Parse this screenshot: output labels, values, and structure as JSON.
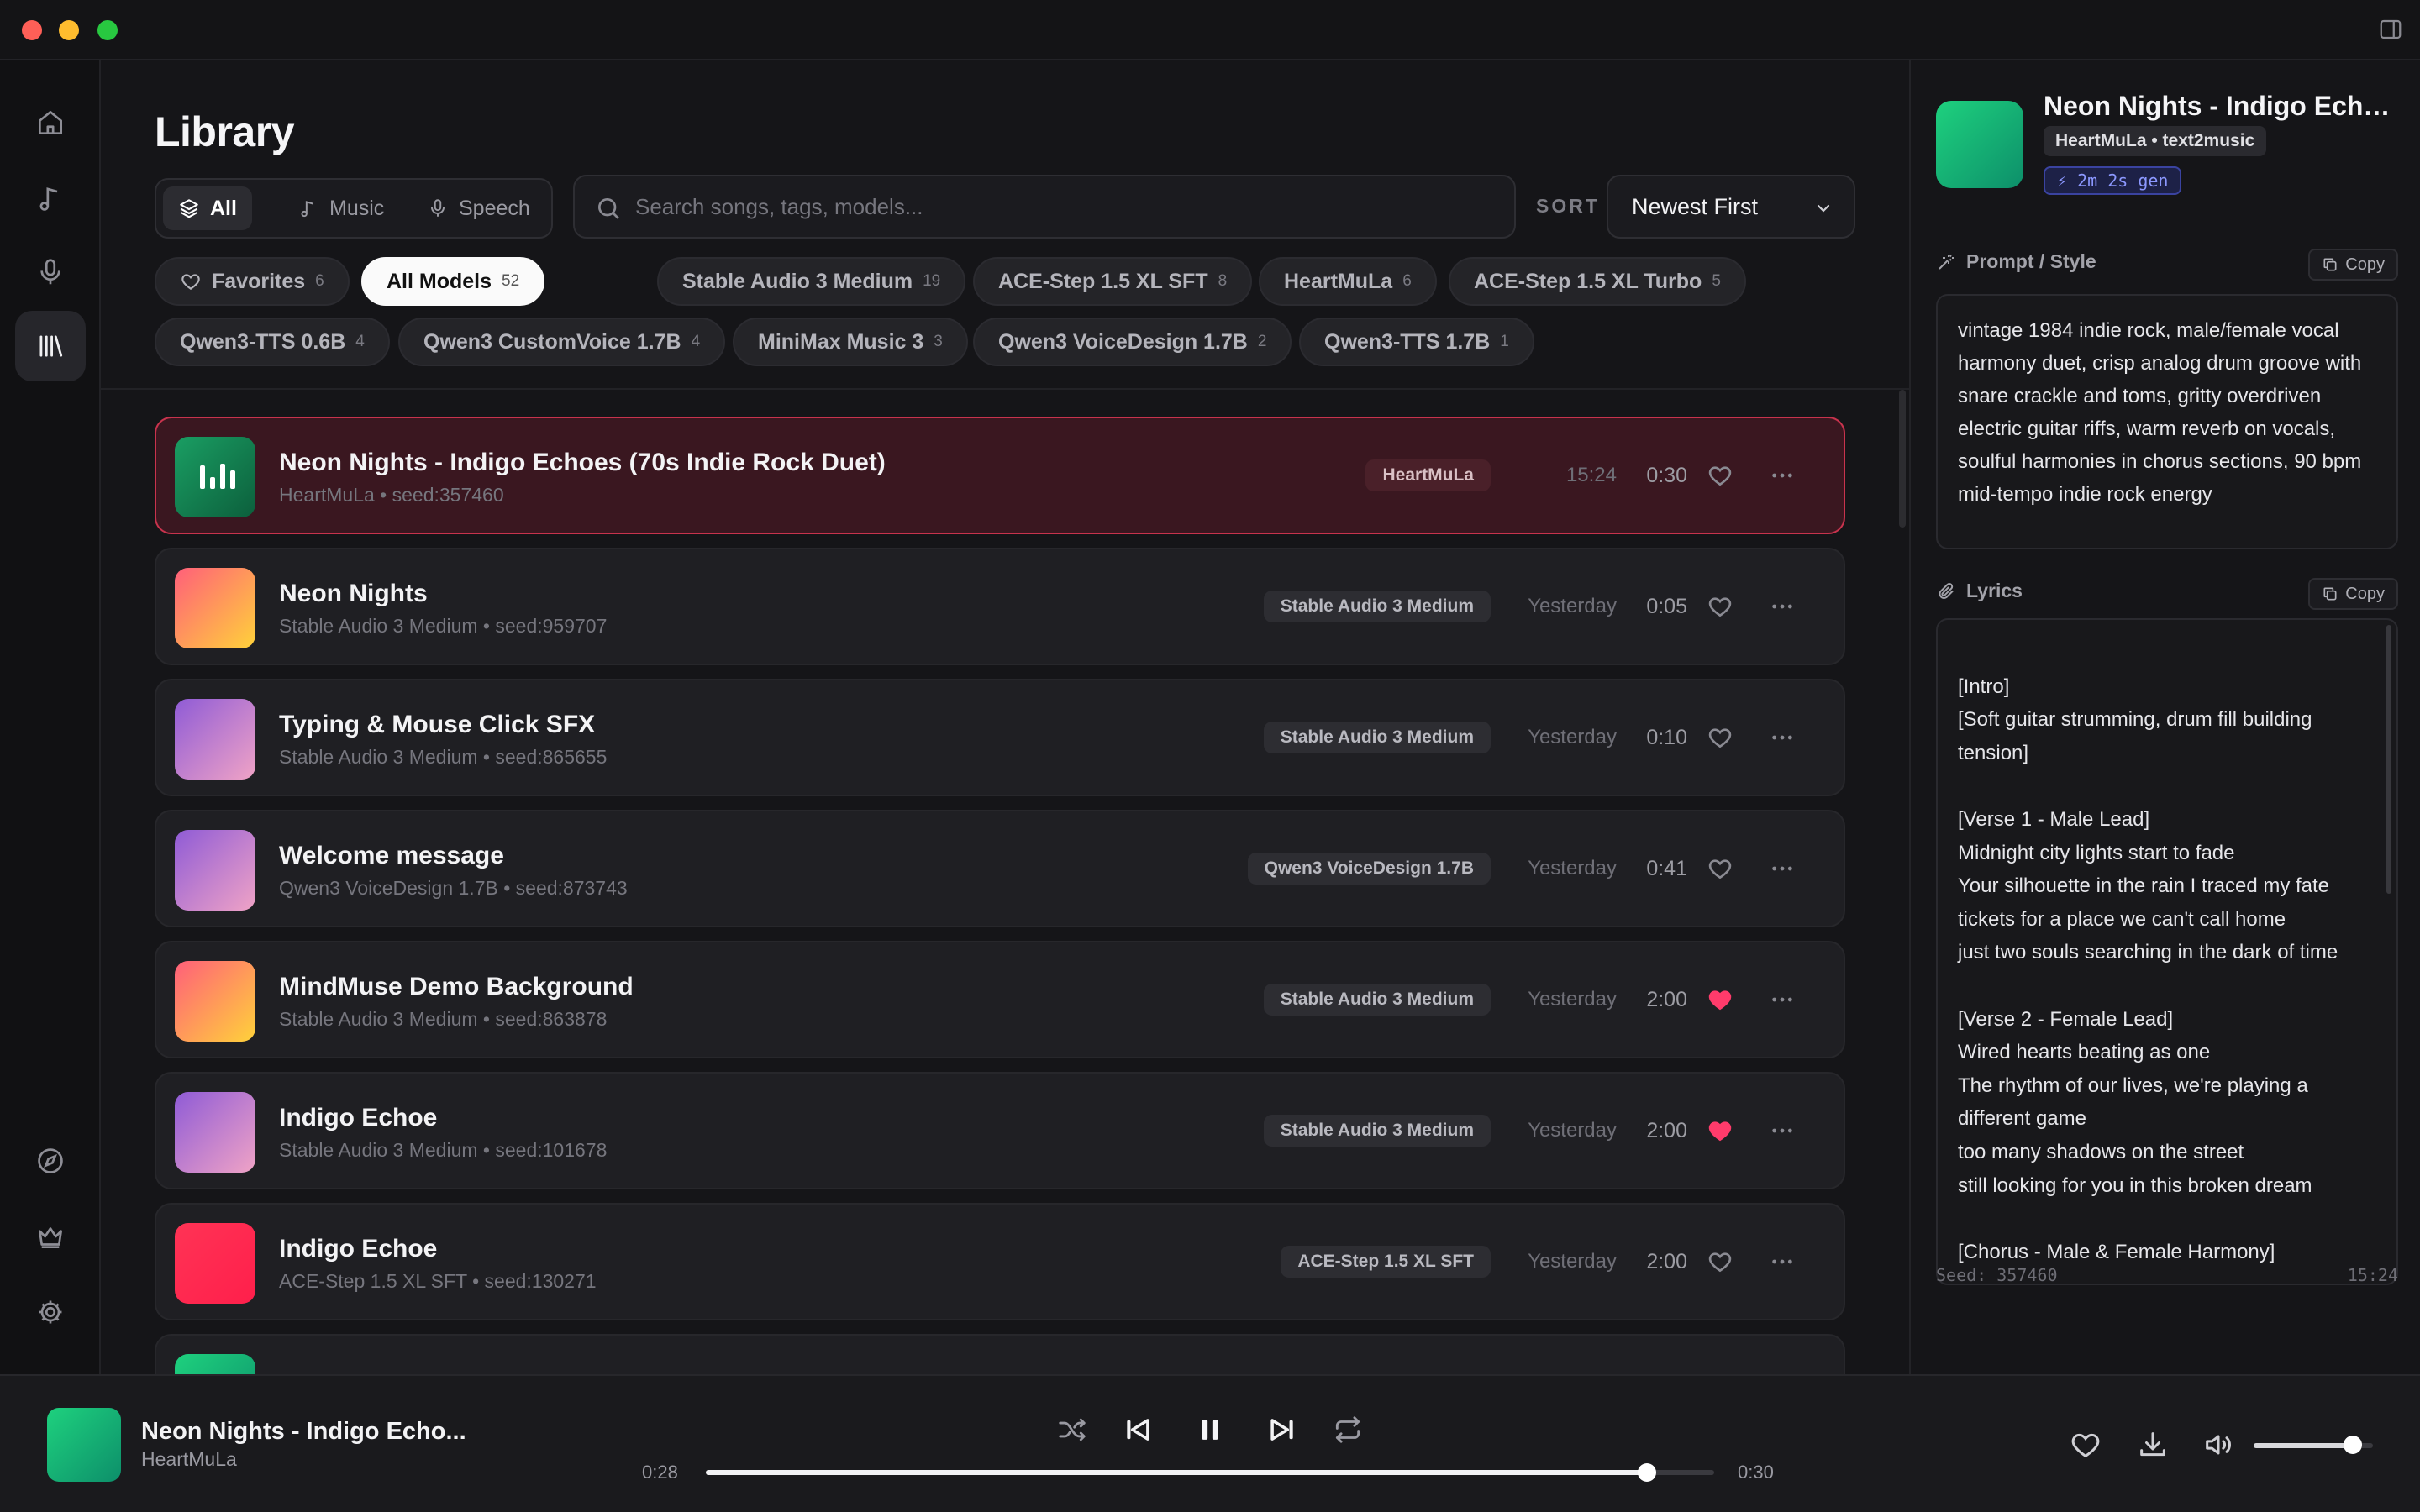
{
  "library": {
    "title": "Library",
    "tabs": [
      {
        "label": "All",
        "active": true,
        "icon": "layers-icon"
      },
      {
        "label": "Music",
        "active": false,
        "icon": "music-note-icon"
      },
      {
        "label": "Speech",
        "active": false,
        "icon": "microphone-icon"
      }
    ],
    "search": {
      "placeholder": "Search songs, tags, models...",
      "value": ""
    },
    "sort": {
      "label": "SORT",
      "value": "Newest First"
    },
    "filters": [
      {
        "label": "Favorites",
        "count": "6",
        "icon": "heart-icon"
      },
      {
        "label": "All Models",
        "count": "52",
        "active": true
      },
      {
        "label": "Stable Audio 3 Medium",
        "count": "19"
      },
      {
        "label": "ACE-Step 1.5 XL SFT",
        "count": "8"
      },
      {
        "label": "HeartMuLa",
        "count": "6"
      },
      {
        "label": "ACE-Step 1.5 XL Turbo",
        "count": "5"
      },
      {
        "label": "Qwen3-TTS 0.6B",
        "count": "4"
      },
      {
        "label": "Qwen3 CustomVoice 1.7B",
        "count": "4"
      },
      {
        "label": "MiniMax Music 3",
        "count": "3"
      },
      {
        "label": "Qwen3 VoiceDesign 1.7B",
        "count": "2"
      },
      {
        "label": "Qwen3-TTS 1.7B",
        "count": "1"
      }
    ],
    "tracks": [
      {
        "title": "Neon Nights - Indigo Echoes (70s Indie Rock Duet)",
        "subtitle": "HeartMuLa • seed:357460",
        "model": "HeartMuLa",
        "date": "15:24",
        "duration": "0:30",
        "favorite": false,
        "selected": true,
        "art": [
          "#1a9e63",
          "#0c5f3c"
        ]
      },
      {
        "title": "Neon Nights",
        "subtitle": "Stable Audio 3 Medium • seed:959707",
        "model": "Stable Audio 3 Medium",
        "date": "Yesterday",
        "duration": "0:05",
        "favorite": false,
        "art": [
          "#ff5f7a",
          "#ffd23a"
        ]
      },
      {
        "title": "Typing & Mouse Click SFX",
        "subtitle": "Stable Audio 3 Medium • seed:865655",
        "model": "Stable Audio 3 Medium",
        "date": "Yesterday",
        "duration": "0:10",
        "favorite": false,
        "art": [
          "#8f5bd6",
          "#f0a3c6"
        ]
      },
      {
        "title": "Welcome message",
        "subtitle": "Qwen3 VoiceDesign 1.7B • seed:873743",
        "model": "Qwen3 VoiceDesign 1.7B",
        "date": "Yesterday",
        "duration": "0:41",
        "favorite": false,
        "art": [
          "#8f5bd6",
          "#f0a3c6"
        ]
      },
      {
        "title": "MindMuse Demo Background",
        "subtitle": "Stable Audio 3 Medium • seed:863878",
        "model": "Stable Audio 3 Medium",
        "date": "Yesterday",
        "duration": "2:00",
        "favorite": true,
        "art": [
          "#ff5f7a",
          "#ffd23a"
        ]
      },
      {
        "title": "Indigo Echoe",
        "subtitle": "Stable Audio 3 Medium • seed:101678",
        "model": "Stable Audio 3 Medium",
        "date": "Yesterday",
        "duration": "2:00",
        "favorite": true,
        "art": [
          "#8f5bd6",
          "#f0a3c6"
        ]
      },
      {
        "title": "Indigo Echoe",
        "subtitle": "ACE-Step 1.5 XL SFT • seed:130271",
        "model": "ACE-Step 1.5 XL SFT",
        "date": "Yesterday",
        "duration": "2:00",
        "favorite": false,
        "art": [
          "#ff3355",
          "#ff1f4b"
        ]
      },
      {
        "title": "",
        "subtitle": "",
        "model": "",
        "date": "",
        "duration": "",
        "favorite": false,
        "art": [
          "#1ed17e",
          "#0d8f6a"
        ]
      }
    ]
  },
  "details": {
    "title": "Neon Nights - Indigo Echoe...",
    "tag": "HeartMuLa • text2music",
    "gen_time": "⚡ 2m 2s gen",
    "prompt_heading": "Prompt / Style",
    "prompt": "vintage 1984 indie rock, male/female vocal harmony duet, crisp analog drum groove with snare crackle and toms, gritty overdriven electric guitar riffs, warm reverb on vocals, soulful harmonies in chorus sections, 90 bpm mid-tempo indie rock energy",
    "lyrics_heading": "Lyrics",
    "copy_label": "Copy",
    "lyrics": "[Intro]\n[Soft guitar strumming, drum fill building tension]\n\n[Verse 1 - Male Lead]\nMidnight city lights start to fade\nYour silhouette in the rain I traced my fate\ntickets for a place we can't call home\njust two souls searching in the dark of time\n\n[Verse 2 - Female Lead]\nWired hearts beating as one\nThe rhythm of our lives, we're playing a different game\ntoo many shadows on the street\nstill looking for you in this broken dream\n\n[Chorus - Male & Female Harmony]",
    "seed": "Seed: 357460",
    "time": "15:24"
  },
  "player": {
    "title": "Neon Nights - Indigo Echo...",
    "artist": "HeartMuLa",
    "current": "0:28",
    "total": "0:30",
    "progress": 0.933,
    "volume": 0.83
  },
  "colors": {
    "accent_pink": "#ff3b6b",
    "selected_border": "#c8334d",
    "gen_badge": "#8c98ff"
  }
}
